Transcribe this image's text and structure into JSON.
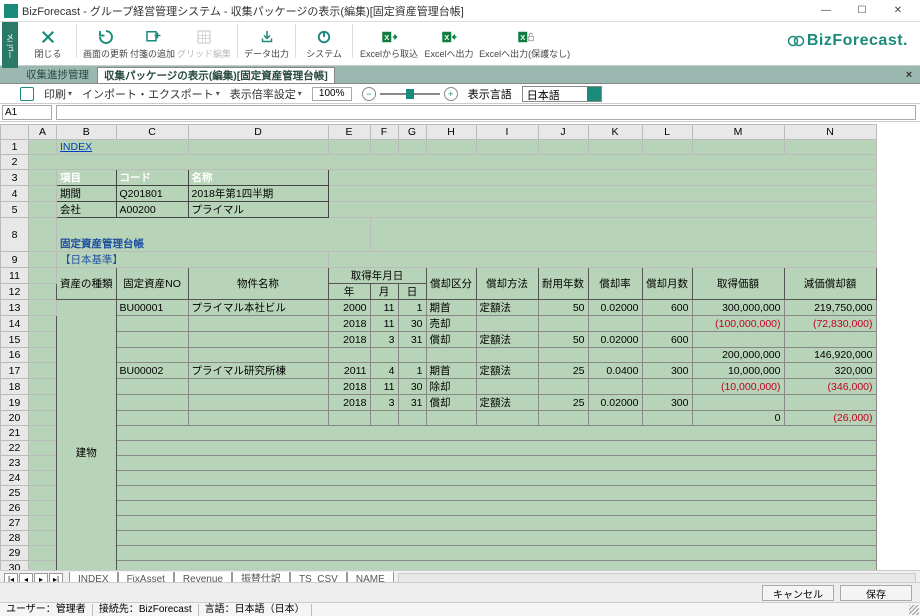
{
  "window": {
    "title": "BizForecast - グループ経営管理システム - 収集パッケージの表示(編集)[固定資産管理台帳]"
  },
  "brand": "BizForecast.",
  "menu_side": "メニュー",
  "toolbar": [
    {
      "icon": "close-x",
      "label": "閉じる",
      "color": "#1a8a7a"
    },
    {
      "icon": "refresh",
      "label": "画面の更新",
      "color": "#1a8a7a"
    },
    {
      "icon": "attach",
      "label": "付箋の追加",
      "color": "#1a8a7a"
    },
    {
      "icon": "grid",
      "label": "グリッド編集",
      "color": "#bbb"
    },
    {
      "icon": "export",
      "label": "データ出力",
      "color": "#1a8a7a"
    },
    {
      "icon": "power",
      "label": "システム",
      "color": "#1a8a7a"
    },
    {
      "icon": "xl-in",
      "label": "Excelから取込",
      "color": "#00703c"
    },
    {
      "icon": "xl-out",
      "label": "Excelへ出力",
      "color": "#00703c"
    },
    {
      "icon": "xl-out-np",
      "label": "Excelへ出力(保護なし)",
      "color": "#00703c"
    }
  ],
  "tabs": {
    "t0": "収集進捗管理",
    "t1": "収集パッケージの表示(編集)[固定資産管理台帳]"
  },
  "fmtbar": {
    "print": "印刷",
    "impexp": "インポート・エクスポート",
    "ratecfg": "表示倍率設定",
    "zoom": "100%",
    "langlabel": "表示言語",
    "lang": "日本語"
  },
  "addr": {
    "cell": "A1",
    "fx": ""
  },
  "cols": [
    "A",
    "B",
    "C",
    "D",
    "E",
    "F",
    "G",
    "H",
    "I",
    "J",
    "K",
    "L",
    "M",
    "N"
  ],
  "sheet": {
    "index_link": "INDEX",
    "meta_hdr": {
      "item": "項目",
      "code": "コード",
      "name": "名称"
    },
    "meta_rows": [
      {
        "item": "期間",
        "code": "Q201801",
        "name": "2018年第1四半期"
      },
      {
        "item": "会社",
        "code": "A00200",
        "name": "プライマル"
      }
    ],
    "title": "固定資産管理台帳",
    "subtitle": "【日本基準】",
    "col_hdr": {
      "kind": "資産の種類",
      "asset_no": "固定資産NO",
      "prop_name": "物件名称",
      "acq_date": "取得年月日",
      "y": "年",
      "m": "月",
      "d": "日",
      "dep_div": "償却区分",
      "dep_method": "償却方法",
      "life": "耐用年数",
      "rate": "償却率",
      "months": "償却月数",
      "acq_amt": "取得価額",
      "accum": "減価償却額"
    },
    "side_label": "建物",
    "rows": [
      {
        "no": "BU00001",
        "name": "プライマル本社ビル",
        "y": "2000",
        "m": "11",
        "d": "1",
        "div": "期首",
        "method": "定額法",
        "life": "50",
        "rate": "0.02000",
        "months": "600",
        "acq": "300,000,000",
        "dep": "219,750,000"
      },
      {
        "no": "",
        "name": "",
        "y": "2018",
        "m": "11",
        "d": "30",
        "div": "売却",
        "method": "",
        "life": "",
        "rate": "",
        "months": "",
        "acq": "(100,000,000)",
        "dep": "(72,830,000)"
      },
      {
        "no": "",
        "name": "",
        "y": "2018",
        "m": "3",
        "d": "31",
        "div": "償却",
        "method": "定額法",
        "life": "50",
        "rate": "0.02000",
        "months": "600",
        "acq": "",
        "dep": ""
      },
      {
        "no": "",
        "name": "",
        "y": "",
        "m": "",
        "d": "",
        "div": "",
        "method": "",
        "life": "",
        "rate": "",
        "months": "",
        "acq": "200,000,000",
        "dep": "146,920,000"
      },
      {
        "no": "BU00002",
        "name": "プライマル研究所棟",
        "y": "2011",
        "m": "4",
        "d": "1",
        "div": "期首",
        "method": "定額法",
        "life": "25",
        "rate": "0.0400",
        "months": "300",
        "acq": "10,000,000",
        "dep": "320,000"
      },
      {
        "no": "",
        "name": "",
        "y": "2018",
        "m": "11",
        "d": "30",
        "div": "除却",
        "method": "",
        "life": "",
        "rate": "",
        "months": "",
        "acq": "(10,000,000)",
        "dep": "(346,000)"
      },
      {
        "no": "",
        "name": "",
        "y": "2018",
        "m": "3",
        "d": "31",
        "div": "償却",
        "method": "定額法",
        "life": "25",
        "rate": "0.02000",
        "months": "300",
        "acq": "",
        "dep": ""
      },
      {
        "no": "",
        "name": "",
        "y": "",
        "m": "",
        "d": "",
        "div": "",
        "method": "",
        "life": "",
        "rate": "",
        "months": "",
        "acq": "0",
        "dep": "(26,000)"
      }
    ]
  },
  "sheet_tabs": [
    "INDEX",
    "FixAsset",
    "Revenue",
    "振替仕訳",
    "TS_CSV",
    "NAME"
  ],
  "buttons": {
    "cancel": "キャンセル",
    "save": "保存"
  },
  "status": {
    "user_l": "ユーザー：",
    "user_v": "管理者",
    "conn_l": "接続先：",
    "conn_v": "BizForecast",
    "lang_l": "言語：",
    "lang_v": "日本語（日本）"
  }
}
